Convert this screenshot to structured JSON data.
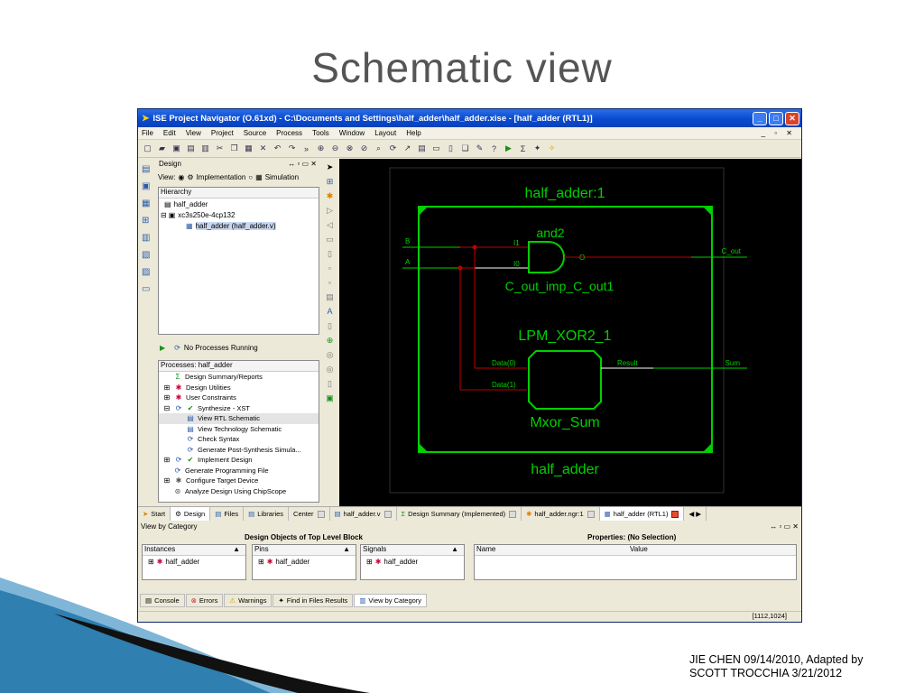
{
  "slide": {
    "title": "Schematic view",
    "credit_line1": "JIE CHEN 09/14/2010, Adapted by",
    "credit_line2": "SCOTT TROCCHIA 3/21/2012"
  },
  "window": {
    "title": "ISE Project Navigator (O.61xd) - C:\\Documents and Settings\\half_adder\\half_adder.xise - [half_adder (RTL1)]",
    "title_icon": "ise-logo-icon"
  },
  "menu": [
    "File",
    "Edit",
    "View",
    "Project",
    "Source",
    "Process",
    "Tools",
    "Window",
    "Layout",
    "Help"
  ],
  "design_panel": {
    "header": "Design",
    "view_label": "View:",
    "implementation_label": "Implementation",
    "simulation_label": "Simulation",
    "hierarchy_label": "Hierarchy",
    "tree": [
      "half_adder",
      "xc3s250e-4cp132",
      "half_adder (half_adder.v)"
    ],
    "status_text": "No Processes Running",
    "processes_header": "Processes: half_adder",
    "processes": [
      "Design Summary/Reports",
      "Design Utilities",
      "User Constraints",
      "Synthesize - XST",
      "View RTL Schematic",
      "View Technology Schematic",
      "Check Syntax",
      "Generate Post-Synthesis Simula...",
      "Implement Design",
      "Generate Programming File",
      "Configure Target Device",
      "Analyze Design Using ChipScope"
    ]
  },
  "schematic": {
    "outer_top_label": "half_adder:1",
    "outer_bottom_label": "half_adder",
    "and_type": "and2",
    "and_instance": "C_out_imp_C_out1",
    "xor_type": "LPM_XOR2_1",
    "xor_instance": "Mxor_Sum",
    "input_b": "B",
    "input_a": "A",
    "pin_i1": "I1",
    "pin_i0": "I0",
    "pin_o": "O",
    "output_cout": "C_out",
    "pin_data0": "Data(0)",
    "pin_data1": "Data(1)",
    "pin_result": "Result",
    "output_sum": "Sum",
    "colors": {
      "box": "#00d000",
      "wire_in": "#c00000",
      "wire": "#ffffff",
      "bg": "#000000"
    }
  },
  "bottom_tabs": [
    "Start",
    "Design",
    "Files",
    "Libraries",
    "Center",
    "half_adder.v",
    "Design Summary (Implemented)",
    "half_adder.ngr:1",
    "half_adder (RTL1)"
  ],
  "view_by_category": {
    "header": "View by Category",
    "design_objects_title": "Design Objects of Top Level Block",
    "properties_title": "Properties: (No Selection)",
    "instances_label": "Instances",
    "pins_label": "Pins",
    "signals_label": "Signals",
    "name_label": "Name",
    "value_label": "Value",
    "item": "half_adder"
  },
  "console_tabs": [
    "Console",
    "Errors",
    "Warnings",
    "Find in Files Results",
    "View by Category"
  ],
  "status_coords": "[1112,1024]"
}
